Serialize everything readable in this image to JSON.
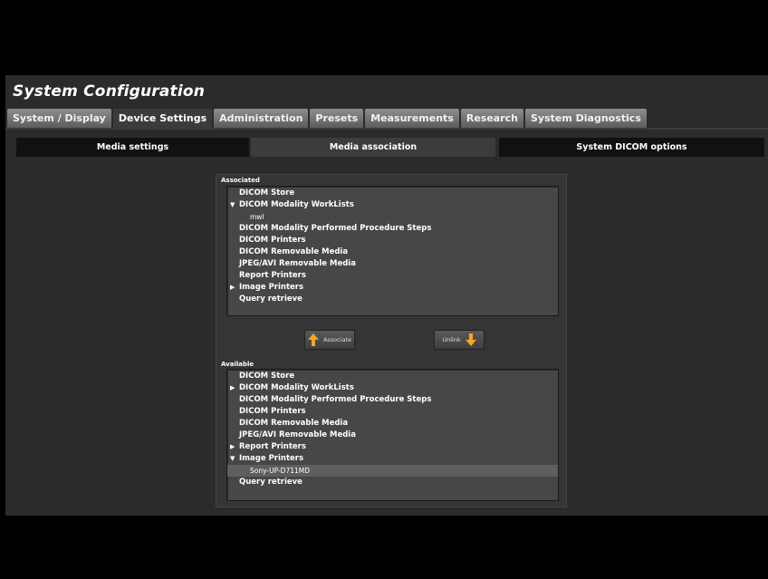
{
  "title": "System Configuration",
  "tabs": [
    {
      "label": "System / Display"
    },
    {
      "label": "Device Settings"
    },
    {
      "label": "Administration"
    },
    {
      "label": "Presets"
    },
    {
      "label": "Measurements"
    },
    {
      "label": "Research"
    },
    {
      "label": "System Diagnostics"
    }
  ],
  "active_tab": "Device Settings",
  "subtabs": [
    {
      "label": "Media settings"
    },
    {
      "label": "Media association"
    },
    {
      "label": "System DICOM options"
    }
  ],
  "active_subtab": "Media association",
  "associated": {
    "label": "Associated",
    "items": [
      {
        "label": "DICOM Store",
        "expander": ""
      },
      {
        "label": "DICOM Modality WorkLists",
        "expander": "▼"
      },
      {
        "label": "mwl",
        "child": true
      },
      {
        "label": "DICOM Modality Performed Procedure Steps",
        "expander": ""
      },
      {
        "label": "DICOM Printers",
        "expander": ""
      },
      {
        "label": "DICOM Removable Media",
        "expander": ""
      },
      {
        "label": "JPEG/AVI Removable Media",
        "expander": ""
      },
      {
        "label": "Report Printers",
        "expander": ""
      },
      {
        "label": "Image Printers",
        "expander": "▶"
      },
      {
        "label": "Query retrieve",
        "expander": ""
      }
    ]
  },
  "buttons": {
    "associate": "Associate",
    "unlink": "Unlink",
    "arrow_color": "#f5a623"
  },
  "available": {
    "label": "Available",
    "items": [
      {
        "label": "DICOM Store",
        "expander": ""
      },
      {
        "label": "DICOM Modality WorkLists",
        "expander": "▶"
      },
      {
        "label": "DICOM Modality Performed Procedure Steps",
        "expander": ""
      },
      {
        "label": "DICOM Printers",
        "expander": ""
      },
      {
        "label": "DICOM Removable Media",
        "expander": ""
      },
      {
        "label": "JPEG/AVI Removable Media",
        "expander": ""
      },
      {
        "label": "Report Printers",
        "expander": "▶"
      },
      {
        "label": "Image Printers",
        "expander": "▼"
      },
      {
        "label": "Sony-UP-D711MD",
        "child": true,
        "selected": true
      },
      {
        "label": "Query retrieve",
        "expander": ""
      }
    ]
  }
}
